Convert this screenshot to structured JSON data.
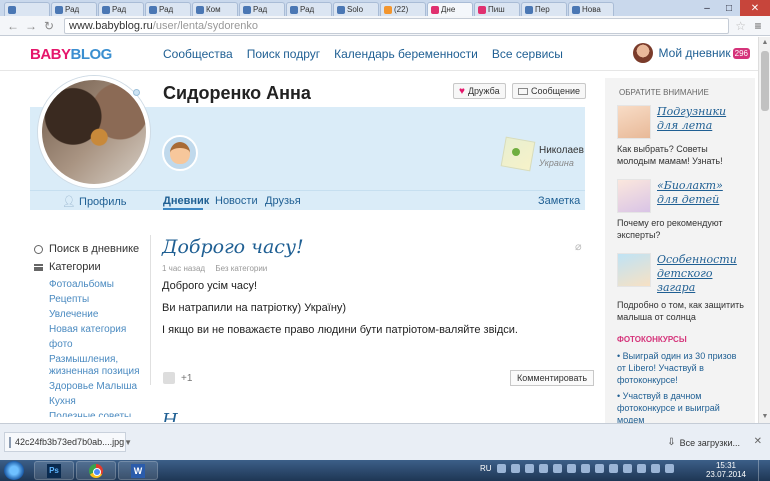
{
  "browser": {
    "tabs": [
      {
        "label": "",
        "icon": "generic",
        "active": false
      },
      {
        "label": "Рад",
        "icon": "generic",
        "active": false
      },
      {
        "label": "Рад",
        "icon": "generic",
        "active": false
      },
      {
        "label": "Рад",
        "icon": "generic",
        "active": false
      },
      {
        "label": "Ком",
        "icon": "generic",
        "active": false
      },
      {
        "label": "Рад",
        "icon": "generic",
        "active": false
      },
      {
        "label": "Рад",
        "icon": "generic",
        "active": false
      },
      {
        "label": "Solo",
        "icon": "generic",
        "active": false
      },
      {
        "label": "(22)",
        "icon": "orange",
        "active": false
      },
      {
        "label": "Дне",
        "icon": "pink",
        "active": true
      },
      {
        "label": "Пиш",
        "icon": "pink",
        "active": false
      },
      {
        "label": "Пер",
        "icon": "generic",
        "active": false
      },
      {
        "label": "Нова",
        "icon": "generic",
        "active": false
      }
    ],
    "url_host": "www.babyblog.ru",
    "url_path": "/user/lenta/sydorenko"
  },
  "site": {
    "logo_part1": "BABY",
    "logo_part2": "BLOG",
    "nav": [
      "Сообщества",
      "Поиск подруг",
      "Календарь беременности",
      "Все сервисы"
    ],
    "my_diary": "Мой дневник",
    "diary_count": "296"
  },
  "profile": {
    "name": "Сидоренко Анна",
    "friend_btn": "Дружба",
    "message_btn": "Сообщение",
    "city": "Николаев",
    "country": "Украина",
    "tabs": {
      "profile": "Профиль",
      "diary": "Дневник",
      "news": "Новости",
      "friends": "Друзья",
      "note": "Заметка"
    }
  },
  "sidebar": {
    "search": "Поиск в дневнике",
    "categories_title": "Категории",
    "categories": [
      "Фотоальбомы",
      "Рецепты",
      "Увлечение",
      "Новая категория",
      "фото",
      "Размышления, жизненная позиция",
      "Здоровье Малыша",
      "Кухня",
      "Полезные советы"
    ]
  },
  "post": {
    "title": "Доброго часу!",
    "time": "1 час назад",
    "category": "Без категории",
    "paragraphs": [
      "Доброго усім часу!",
      "Ви натрапили на патріотку) Україну)",
      "І якщо ви не поважаєте право людини бути патріотом-валяйте звідси."
    ],
    "likes": "+1",
    "comment_btn": "Комментировать",
    "next_title": "Н"
  },
  "rightbar": {
    "heading": "ОБРАТИТЕ ВНИМАНИЕ",
    "promos": [
      {
        "title": "Подгузники для лета",
        "text": "Как выбрать? Советы молодым мамам! Узнать!"
      },
      {
        "title": "«Биолакт» для детей",
        "text": "Почему его рекомендуют эксперты?"
      },
      {
        "title": "Особенности детского загара",
        "text": "Подробно о том, как защитить малыша от солнца"
      }
    ],
    "contest_heading": "ФОТОКОНКУРСЫ",
    "contests": [
      "• Выиграй один из 30 призов от Libero! Участвуй в фотоконкурсе!",
      "• Участвуй в дачном фотоконкурсе и выиграй модем"
    ]
  },
  "downloads": {
    "file": "42c24fb3b73ed7b0ab....jpg",
    "all": "Все загрузки..."
  },
  "taskbar": {
    "lang": "RU",
    "time": "15:31",
    "date": "23.07.2014"
  }
}
